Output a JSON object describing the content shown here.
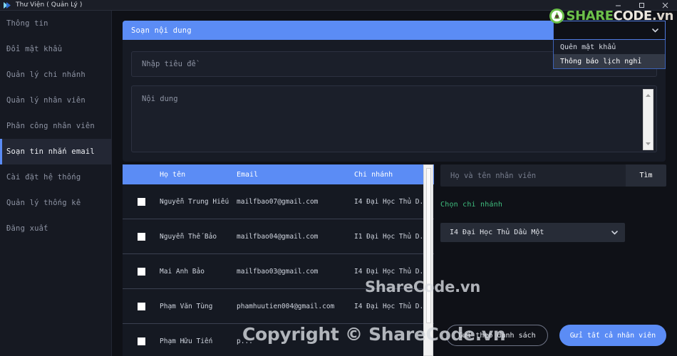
{
  "window": {
    "title": "Thư Viện ( Quản Lý )",
    "icon": "app-flag-icon",
    "minimize": "minimize-icon",
    "maximize": "maximize-icon",
    "close": "close-icon"
  },
  "branding": {
    "logo_share": "SHARE",
    "logo_code": "CODE",
    "logo_vn": ".vn",
    "watermark_mid": "ShareCode.vn",
    "watermark_bottom": "Copyright © ShareCode.vn"
  },
  "sidebar": {
    "items": [
      {
        "label": "Thông tin",
        "active": false
      },
      {
        "label": "Đổi mật khẩu",
        "active": false
      },
      {
        "label": "Quản lý chi nhánh",
        "active": false
      },
      {
        "label": "Quản lý nhân viên",
        "active": false
      },
      {
        "label": "Phân công nhân viên",
        "active": false
      },
      {
        "label": "Soạn tin nhắn email",
        "active": true
      },
      {
        "label": "Cài đặt hệ thống",
        "active": false
      },
      {
        "label": "Quản lý thống kê",
        "active": false
      },
      {
        "label": "Đăng xuất",
        "active": false
      }
    ]
  },
  "compose": {
    "header_title": "Soạn nội dung",
    "template_select": {
      "value": "",
      "caret": "chevron-down-icon",
      "open": true,
      "options": [
        {
          "label": "Quên mật khẩu",
          "highlighted": false
        },
        {
          "label": "Thông báo lịch nghỉ",
          "highlighted": true
        }
      ]
    },
    "title_field": {
      "value": "",
      "placeholder": "Nhập tiêu đề"
    },
    "body_field": {
      "value": "",
      "placeholder": "Nội dung"
    },
    "body_scrollbar": {
      "up": "scroll-up-arrow-icon",
      "down": "scroll-down-arrow-icon"
    }
  },
  "table": {
    "columns": [
      "",
      "Họ tên",
      "Email",
      "Chi nhánh"
    ],
    "rows": [
      {
        "checked": false,
        "name": "Nguyễn Trung Hiếu",
        "email": "mailfbao07@gmail.com",
        "branch": "I4 Đại Học Thủ D..."
      },
      {
        "checked": false,
        "name": "Nguyễn Thế Bảo",
        "email": "mailfbao04@gmail.com",
        "branch": "I1 Đại Học Thủ D..."
      },
      {
        "checked": false,
        "name": "Mai Anh Bảo",
        "email": "mailfbao03@gmail.com",
        "branch": "I4 Đại Học Thủ D..."
      },
      {
        "checked": false,
        "name": "Phạm Văn Tùng",
        "email": "phamhuutien004@gmail.com",
        "branch": "I4 Đại Học Thủ D..."
      },
      {
        "checked": false,
        "name": "Phạm Hữu Tiến",
        "email": "p...",
        "branch": ""
      }
    ]
  },
  "right_panel": {
    "search": {
      "value": "",
      "placeholder": "Họ và tên nhân viên"
    },
    "search_button": "Tìm",
    "branch_label": "Chọn chi nhánh",
    "branch_select": {
      "value": "I4 Đại Học Thủ Dầu Một",
      "caret": "chevron-down-icon"
    },
    "send_list_button": "Gửi theo danh sách",
    "send_all_button": "Gửi tất cả nhân viên"
  },
  "colors": {
    "accent": "#5b8cf5",
    "sidebar_bg": "#161922",
    "page_bg": "#0f1117",
    "green_label": "#3fbf7f",
    "logo_green": "#6cc04a"
  }
}
